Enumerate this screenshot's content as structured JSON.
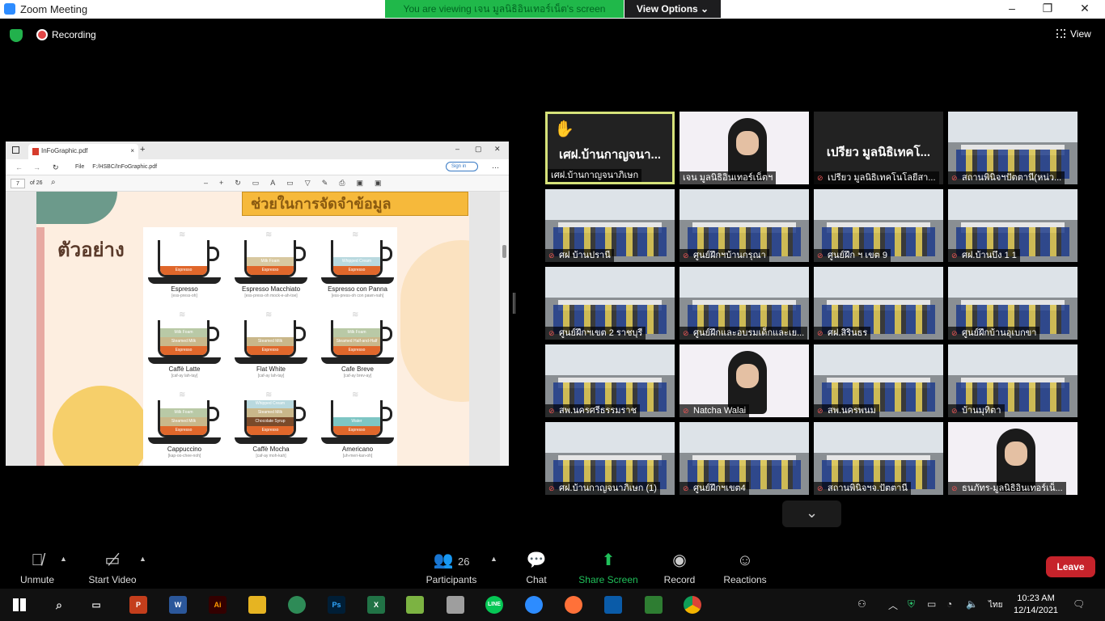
{
  "window": {
    "title": "Zoom Meeting",
    "min": "–",
    "max": "❐",
    "close": "✕"
  },
  "share_banner": {
    "text": "You are viewing เจน มูลนิธิอินเทอร์เน็ต's screen",
    "view_options": "View Options ⌄"
  },
  "status": {
    "recording": "Recording",
    "view": "View"
  },
  "browser": {
    "tab_title": "InFoGraphic.pdf",
    "tab_close": "×",
    "new_tab": "+",
    "url_prefix": "File",
    "url": "F:/HSBC/InFoGraphic.pdf",
    "sign_in": "Sign in",
    "page_number": "7",
    "page_of": "of 26"
  },
  "pdf": {
    "banner_text": "ช่วยในการจัดจำข้อมูล",
    "sample_title": "ตัวอย่าง",
    "cups": [
      {
        "name": "Espresso",
        "pron": "[ess-press-oh]",
        "layers": [
          {
            "t": "Espresso",
            "c": "#e0672b"
          }
        ]
      },
      {
        "name": "Espresso Macchiato",
        "pron": "[ess-press-oh mock-e-ah-toe]",
        "layers": [
          {
            "t": "Milk Foam",
            "c": "#d8c8a0"
          },
          {
            "t": "Espresso",
            "c": "#e0672b"
          }
        ]
      },
      {
        "name": "Espresso con Panna",
        "pron": "[ess-press-oh con pawn-nah]",
        "layers": [
          {
            "t": "Whipped Cream",
            "c": "#b9d9df"
          },
          {
            "t": "Espresso",
            "c": "#e0672b"
          }
        ]
      },
      {
        "name": "Caffè Latte",
        "pron": "[caf-ay lah-tay]",
        "layers": [
          {
            "t": "Milk Foam",
            "c": "#b9c9a6"
          },
          {
            "t": "Steamed Milk",
            "c": "#c9b78a"
          },
          {
            "t": "Espresso",
            "c": "#e0672b"
          }
        ]
      },
      {
        "name": "Flat White",
        "pron": "[caf-ay lah-tay]",
        "layers": [
          {
            "t": "Steamed Milk",
            "c": "#c9b78a"
          },
          {
            "t": "Espresso",
            "c": "#e0672b"
          }
        ]
      },
      {
        "name": "Cafe Breve",
        "pron": "[caf-ay brev-ay]",
        "layers": [
          {
            "t": "Milk Foam",
            "c": "#b9c9a6"
          },
          {
            "t": "Steamed Half-and-Half",
            "c": "#c9b78a"
          },
          {
            "t": "Espresso",
            "c": "#e0672b"
          }
        ]
      },
      {
        "name": "Cappuccino",
        "pron": "[kap-oo-chee-noh]",
        "layers": [
          {
            "t": "Milk Foam",
            "c": "#b9c9a6"
          },
          {
            "t": "Steamed Milk",
            "c": "#c9b78a"
          },
          {
            "t": "Espresso",
            "c": "#e0672b"
          }
        ]
      },
      {
        "name": "Caffè Mocha",
        "pron": "[caf-ay moh-kah]",
        "layers": [
          {
            "t": "Whipped Cream",
            "c": "#b9d9df"
          },
          {
            "t": "Steamed Milk",
            "c": "#c9b78a"
          },
          {
            "t": "Chocolate Syrup",
            "c": "#7a4a2a"
          },
          {
            "t": "Espresso",
            "c": "#e0672b"
          }
        ]
      },
      {
        "name": "Americano",
        "pron": "[uh-meri-kan-oh]",
        "layers": [
          {
            "t": "Water",
            "c": "#7ec6c4"
          },
          {
            "t": "Espresso",
            "c": "#e0672b"
          }
        ]
      }
    ]
  },
  "participants_tiles": [
    {
      "label": "เศฝ.บ้านกาญจนาภิเษก",
      "big": "เศฝ.บ้านกาญจนา...",
      "kind": "name",
      "active": true,
      "hand": "✋",
      "muted": false
    },
    {
      "label": "เจน มูลนิธิอินเทอร์เน็ตฯ",
      "kind": "slide",
      "muted": false
    },
    {
      "label": "เปรียว มูลนิธิเทคโนโลยีสา...",
      "big": "เปรียว มูลนิธิเทคโ...",
      "kind": "name",
      "muted": true
    },
    {
      "label": "สถานพินิจฯปัตตานี(หน่ว...",
      "kind": "room",
      "muted": true
    },
    {
      "label": "ศฝ บ้านปรานี",
      "kind": "room",
      "muted": true
    },
    {
      "label": "ศูนย์ฝึกฯบ้านกรุณา",
      "kind": "room",
      "muted": true
    },
    {
      "label": "ศูนย์ฝึก ฯ เขต 9",
      "kind": "room",
      "muted": true
    },
    {
      "label": "ศฝ.บ้านบึง 1 1",
      "kind": "room",
      "muted": true
    },
    {
      "label": "ศูนย์ฝึกฯเขต 2 ราชบุรี",
      "kind": "room",
      "muted": true
    },
    {
      "label": "ศูนย์ฝึกและอบรมเด็กและเย...",
      "kind": "room",
      "muted": true
    },
    {
      "label": "ศฝ.สิรินธร",
      "kind": "room",
      "muted": true
    },
    {
      "label": "ศูนย์ฝึกบ้านอุเบกขา",
      "kind": "room",
      "muted": true
    },
    {
      "label": "สพ.นครศรีธรรมราช",
      "kind": "room",
      "muted": true
    },
    {
      "label": "Natcha Walai",
      "kind": "slide",
      "muted": true
    },
    {
      "label": "สพ.นครพนม",
      "kind": "room",
      "muted": true
    },
    {
      "label": "บ้านมุทิตา",
      "kind": "room",
      "muted": true
    },
    {
      "label": "ศฝ.บ้านกาญจนาภิเษก (1)",
      "kind": "room",
      "muted": true
    },
    {
      "label": "ศูนย์ฝึกฯเขต4",
      "kind": "room",
      "muted": true
    },
    {
      "label": "สถานพินิจฯจ.ปัตตานี",
      "kind": "room",
      "muted": true
    },
    {
      "label": "ธนภัทร-มูลนิธิอินเทอร์เน็...",
      "kind": "slide",
      "muted": true
    }
  ],
  "controls": {
    "unmute": "Unmute",
    "start_video": "Start Video",
    "participants_count": "26",
    "participants": "Participants",
    "chat": "Chat",
    "share_screen": "Share Screen",
    "record": "Record",
    "reactions": "Reactions",
    "leave": "Leave"
  },
  "taskbar": {
    "time": "10:23 AM",
    "date": "12/14/2021",
    "lang": "ไทย"
  },
  "colors": {
    "share_green": "#20b84a",
    "leave_red": "#c6232b",
    "active_tile_border": "#d6e27a"
  }
}
